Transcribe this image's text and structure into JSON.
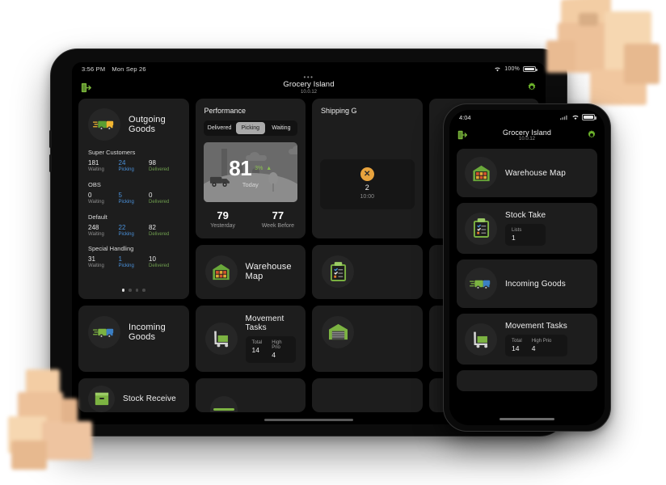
{
  "tablet": {
    "status_bar": {
      "time": "3:56 PM",
      "date": "Mon Sep 26",
      "battery_percent": "100%",
      "wifi_icon": "wifi-icon",
      "battery_icon": "battery-icon"
    },
    "nav": {
      "exit_icon": "exit-door-icon",
      "gear_icon": "gear-icon",
      "overflow_dots": "•••",
      "title": "Grocery Island",
      "version": "10.0.12"
    },
    "outgoing_goods": {
      "title": "Outgoing Goods",
      "icon": "delivery-truck-icon",
      "groups": [
        {
          "name": "Super Customers",
          "waiting": "181",
          "picking": "24",
          "delivered": "98"
        },
        {
          "name": "OBS",
          "waiting": "0",
          "picking": "5",
          "delivered": "0"
        },
        {
          "name": "Default",
          "waiting": "248",
          "picking": "22",
          "delivered": "82"
        },
        {
          "name": "Special Handling",
          "waiting": "31",
          "picking": "1",
          "delivered": "10"
        }
      ],
      "labels": {
        "waiting": "Waiting",
        "picking": "Picking",
        "delivered": "Delivered"
      },
      "page_count": 4,
      "page_active": 1
    },
    "performance": {
      "title": "Performance",
      "tabs": [
        {
          "label": "Delivered",
          "selected": false
        },
        {
          "label": "Picking",
          "selected": true
        },
        {
          "label": "Waiting",
          "selected": false
        }
      ],
      "today_value": "81",
      "today_label": "Today",
      "delta": "3%",
      "delta_direction": "up",
      "delta_color": "#8cc152",
      "yesterday_value": "79",
      "yesterday_label": "Yesterday",
      "week_before_value": "77",
      "week_before_label": "Week Before"
    },
    "shipping_gates": {
      "title": "Shipping G",
      "badge_icon": "x-circle-icon",
      "badge_color": "#e8a33d",
      "count": "2",
      "time": "10:00"
    },
    "warehouse_map": {
      "title": "Warehouse Map",
      "icon": "warehouse-map-icon"
    },
    "movement_tasks": {
      "title": "Movement Tasks",
      "icon": "pallet-cart-icon",
      "stats": [
        {
          "label": "Total",
          "value": "14"
        },
        {
          "label": "High Prio",
          "value": "4"
        }
      ]
    },
    "incoming_goods": {
      "title": "Incoming Goods",
      "icon": "incoming-truck-icon"
    },
    "stock_receive": {
      "title": "Stock Receive",
      "icon": "stock-receive-icon"
    },
    "stock_take_tile": {
      "icon": "clipboard-check-icon"
    },
    "dock_tile": {
      "icon": "warehouse-door-icon"
    }
  },
  "phone": {
    "status_bar": {
      "time": "4:04",
      "signal_icon": "signal-icon",
      "wifi_icon": "wifi-icon",
      "battery_icon": "battery-icon"
    },
    "nav": {
      "exit_icon": "exit-door-icon",
      "gear_icon": "gear-icon",
      "title": "Grocery Island",
      "version": "10.0.12"
    },
    "cards": [
      {
        "title": "Warehouse Map",
        "icon": "warehouse-map-icon",
        "stats": []
      },
      {
        "title": "Stock Take",
        "icon": "clipboard-check-icon",
        "stats": [
          {
            "label": "Lists",
            "value": "1"
          }
        ]
      },
      {
        "title": "Incoming Goods",
        "icon": "incoming-truck-icon",
        "stats": []
      },
      {
        "title": "Movement Tasks",
        "icon": "pallet-cart-icon",
        "stats": [
          {
            "label": "Total",
            "value": "14"
          },
          {
            "label": "High Prio",
            "value": "4"
          }
        ]
      }
    ]
  },
  "decor": {
    "boxes_top_right": "cardboard-boxes",
    "boxes_bottom_left": "cardboard-boxes",
    "box_color": "#f0c9a0"
  }
}
